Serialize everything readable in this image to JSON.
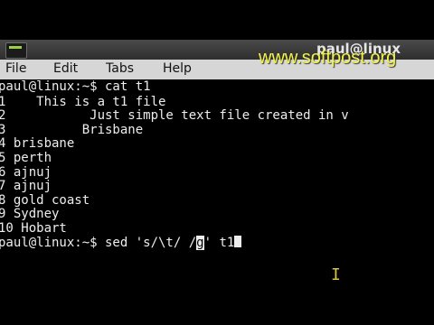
{
  "window": {
    "title": "paul@linux"
  },
  "watermark": "www.softpost.org",
  "menu": [
    {
      "label": "File"
    },
    {
      "label": "Edit"
    },
    {
      "label": "Tabs"
    },
    {
      "label": "Help"
    }
  ],
  "terminal": {
    "prompt1": "paul@linux:~$ cat t1",
    "output": [
      "1    This is a t1 file",
      "2           Just simple text file created in v",
      "3          Brisbane",
      "4 brisbane",
      "5 perth",
      "6 ajnuj",
      "7 ajnuj",
      "8 gold coast",
      "9 Sydney",
      "10 Hobart"
    ],
    "prompt2_before": "paul@linux:~$ sed 's/\\t/ /",
    "prompt2_cursor_char": "g",
    "prompt2_after": "' t1"
  },
  "icons": {
    "app": "terminal-icon",
    "pointer": "text-cursor-icon"
  }
}
